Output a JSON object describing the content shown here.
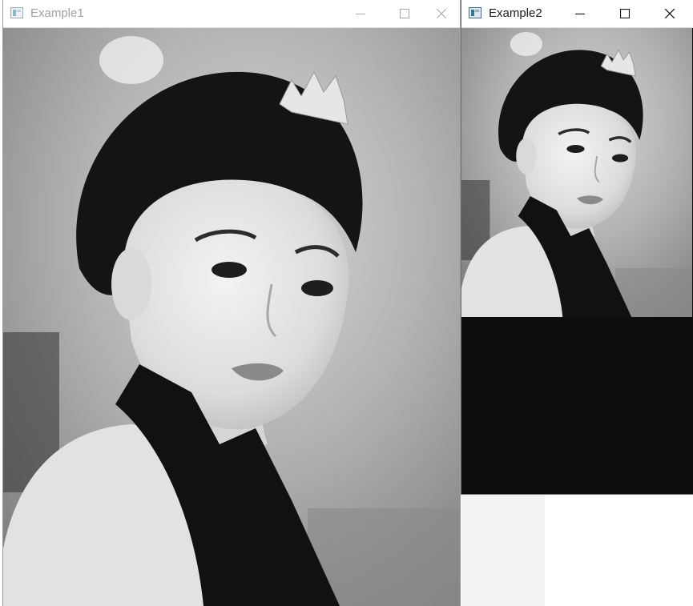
{
  "windows": [
    {
      "title": "Example1",
      "active": false,
      "controls": [
        "minimize-icon",
        "maximize-icon",
        "close-icon"
      ]
    },
    {
      "title": "Example2",
      "active": true,
      "controls": [
        "minimize-icon",
        "maximize-icon",
        "close-icon"
      ]
    }
  ],
  "colors": {
    "inactive_title": "#a0a0a0",
    "active_title": "#1a1a1a",
    "image_empty_area": "#0d0d0d"
  }
}
